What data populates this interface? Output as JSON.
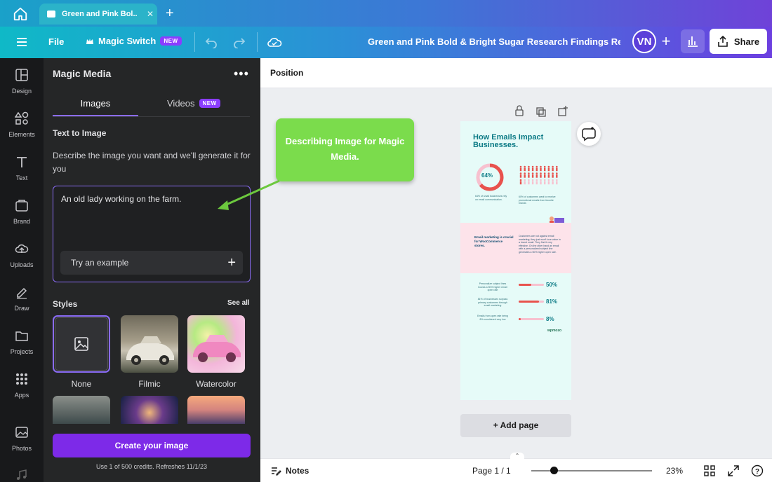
{
  "browser": {
    "tab_title": "Green and Pink Bol...",
    "tab_close": "✕",
    "new_tab": "+"
  },
  "header": {
    "file": "File",
    "magic_switch": "Magic Switch",
    "magic_badge": "NEW",
    "doc_title": "Green and Pink Bold & Bright Sugar Research Findings Repo...",
    "avatar": "VN",
    "add": "+",
    "share": "Share"
  },
  "rail": [
    {
      "label": "Design",
      "icon": "design-icon"
    },
    {
      "label": "Elements",
      "icon": "elements-icon"
    },
    {
      "label": "Text",
      "icon": "text-icon"
    },
    {
      "label": "Brand",
      "icon": "brand-icon"
    },
    {
      "label": "Uploads",
      "icon": "uploads-icon"
    },
    {
      "label": "Draw",
      "icon": "draw-icon"
    },
    {
      "label": "Projects",
      "icon": "projects-icon"
    },
    {
      "label": "Apps",
      "icon": "apps-icon"
    },
    {
      "label": "Photos",
      "icon": "photos-icon"
    }
  ],
  "panel": {
    "title": "Magic Media",
    "more": "•••",
    "tab_images": "Images",
    "tab_videos": "Videos",
    "videos_badge": "NEW",
    "section_text_to_image": "Text to Image",
    "description": "Describe the image you want and we'll generate it for you",
    "prompt_value": "An old lady working on the farm.",
    "try_example": "Try an example",
    "styles_label": "Styles",
    "see_all": "See all",
    "styles": [
      {
        "label": "None"
      },
      {
        "label": "Filmic"
      },
      {
        "label": "Watercolor"
      }
    ],
    "create_button": "Create your image",
    "credits": "Use 1 of 500 credits. Refreshes 11/1/23"
  },
  "canvas": {
    "toolbar_position": "Position",
    "callout": "Describing Image for Magic Media.",
    "add_page": "+ Add page",
    "design": {
      "title": "How Emails Impact Businesses.",
      "donut_value": "64%",
      "donut_fraction": 0.64,
      "caption_left": "64% of small businesses rely on email communication.",
      "caption_right": "60% of customers want to receive promotional emails from favorite brands",
      "pink_heading": "Email marketing is crucial for WooCommerce stores.",
      "pink_body": "Customers are not against email marketing; they just won't love value in a brand email. They find it very effective. On the other hand an email with a personalized subject line generates a 50% higher open rate.",
      "stats": [
        {
          "label": "Personalize subject lines boosts a 50% higher email open rate",
          "value": "50%",
          "fraction": 0.5
        },
        {
          "label": "81% of businesses surpass primary customers through email marketing",
          "value": "81%",
          "fraction": 0.81
        },
        {
          "label": "Emails from open rate being 8% considered very low",
          "value": "8%",
          "fraction": 0.08
        }
      ],
      "brand": "wpmozo"
    }
  },
  "bottom": {
    "notes": "Notes",
    "page_info": "Page 1 / 1",
    "zoom": "23%",
    "zoom_level": 0.23
  }
}
